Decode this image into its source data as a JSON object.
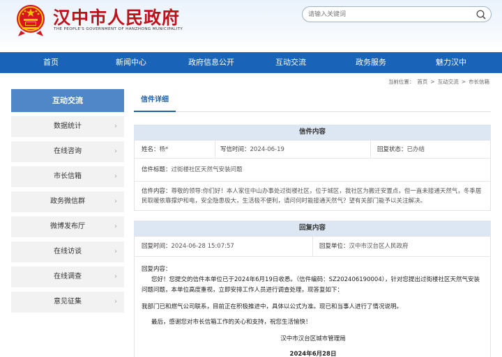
{
  "header": {
    "title": "汉中市人民政府",
    "subtitle": "THE PEOPLE'S GOVERNMENT OF HANZHONG MUNICIPALITY",
    "search_placeholder": "请输入关键词"
  },
  "nav": [
    "首页",
    "新闻中心",
    "政府信息公开",
    "互动交流",
    "政务服务",
    "魅力汉中"
  ],
  "breadcrumb": {
    "prefix": "当前位置：",
    "items": [
      "首页",
      ">",
      "互动交流",
      ">",
      "市长信箱"
    ]
  },
  "sidebar": {
    "title": "互动交流",
    "items": [
      "数据统计",
      "在线咨询",
      "市长信箱",
      "政务微信群",
      "微博发布厅",
      "在线访谈",
      "在线调查",
      "意见征集"
    ]
  },
  "tab": "信件详细",
  "letter": {
    "section_title": "信件内容",
    "name_label": "姓名：",
    "name": "杨*",
    "time_label": "写信时间：",
    "time": "2024-06-19",
    "status_label": "回复状态：",
    "status": "已办结",
    "subject_label": "信件标题：",
    "subject": "过街楼社区天然气安装问题",
    "content_label": "信件内容：",
    "content": "尊敬的领导:你们好！本人家住中山办事处过街楼社区，位于城区，我社区为搬迁安置点，但一直未接通天然气，冬季居民取暖依靠撑炉和电，安全隐患极大，生活极不便利，请问何时能接通天然气？望有关部门能予以关注解决。"
  },
  "reply": {
    "section_title": "回复内容",
    "time_label": "回复时间：",
    "time": "2024-06-28 15:07:57",
    "unit_label": "回复单位：",
    "unit": "汉中市汉台区人民政府",
    "content_label": "回复内容：",
    "p1": "您好！您提交的信件本单位已于2024年6月19日收悉。（信件编码：SZ202406190004），针对您提出过街楼社区天然气安装问题问题，本单位高度重视，立即安排工作人员进行调查处理，现答复如下：",
    "p2": "我部门已和燃气公司联系，目前正在积极推进中，具体以公式为准。现已和当事人进行了情况说明。",
    "p3": "最后，感谢您对市长信箱工作的关心和支持，祝您生活愉快！",
    "signature": "汉中市汉台区城市管理局",
    "date": "2024年6月28日"
  },
  "colors": {
    "nav_bg": "#1964b8",
    "title_red": "#c0101a",
    "sidebar_header": "#4f87c9",
    "section_bg": "#dde7f3"
  }
}
